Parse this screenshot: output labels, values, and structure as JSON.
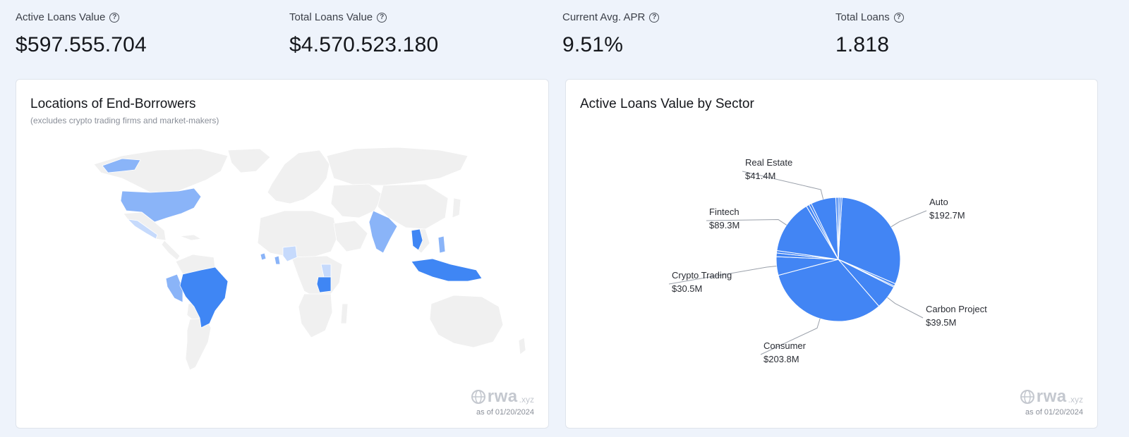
{
  "stats": [
    {
      "label": "Active Loans Value",
      "value": "$597.555.704"
    },
    {
      "label": "Total Loans Value",
      "value": "$4.570.523.180"
    },
    {
      "label": "Current Avg. APR",
      "value": "9.51%"
    },
    {
      "label": "Total Loans",
      "value": "1.818"
    }
  ],
  "help_icon_glyph": "?",
  "map_card": {
    "title": "Locations of End-Borrowers",
    "subtitle": "(excludes crypto trading firms and market-makers)",
    "watermark_brand": "rwa",
    "watermark_suffix": ".xyz",
    "as_of": "as of 01/20/2024"
  },
  "sector_card": {
    "title": "Active Loans Value by Sector",
    "watermark_brand": "rwa",
    "watermark_suffix": ".xyz",
    "as_of": "as of 01/20/2024"
  },
  "colors": {
    "dark_blue": "#3f86f4",
    "mid_blue": "#8ab4f8",
    "light_blue": "#c6dafc",
    "land": "#f0f0f0",
    "border": "#ffffff"
  },
  "map_highlights": [
    {
      "country": "Brazil",
      "shade": "dark"
    },
    {
      "country": "Tanzania",
      "shade": "dark"
    },
    {
      "country": "Thailand",
      "shade": "dark"
    },
    {
      "country": "Indonesia",
      "shade": "dark"
    },
    {
      "country": "Philippines",
      "shade": "mid"
    },
    {
      "country": "India",
      "shade": "mid"
    },
    {
      "country": "United States",
      "shade": "mid"
    },
    {
      "country": "Alaska",
      "shade": "mid"
    },
    {
      "country": "Mexico",
      "shade": "light"
    },
    {
      "country": "Peru",
      "shade": "mid"
    },
    {
      "country": "Nigeria",
      "shade": "light"
    },
    {
      "country": "Kenya",
      "shade": "light"
    },
    {
      "country": "Ghana",
      "shade": "mid"
    },
    {
      "country": "Sierra Leone",
      "shade": "mid"
    }
  ],
  "chart_data": {
    "type": "pie",
    "title": "Active Loans Value by Sector",
    "slices": [
      {
        "label": "Auto",
        "value": 192.7,
        "display": "$192.7M"
      },
      {
        "label": "",
        "value": 4.0,
        "display": ""
      },
      {
        "label": "",
        "value": 2.0,
        "display": ""
      },
      {
        "label": "Carbon Project",
        "value": 39.5,
        "display": "$39.5M"
      },
      {
        "label": "Consumer",
        "value": 203.8,
        "display": "$203.8M"
      },
      {
        "label": "Crypto Trading",
        "value": 30.5,
        "display": "$30.5M"
      },
      {
        "label": "",
        "value": 6.0,
        "display": ""
      },
      {
        "label": "",
        "value": 4.0,
        "display": ""
      },
      {
        "label": "Fintech",
        "value": 89.3,
        "display": "$89.3M"
      },
      {
        "label": "",
        "value": 5.0,
        "display": ""
      },
      {
        "label": "",
        "value": 4.0,
        "display": ""
      },
      {
        "label": "Real Estate",
        "value": 41.4,
        "display": "$41.4M"
      },
      {
        "label": "",
        "value": 4.0,
        "display": ""
      },
      {
        "label": "",
        "value": 3.0,
        "display": ""
      },
      {
        "label": "",
        "value": 3.0,
        "display": ""
      }
    ],
    "color": "#4285f4"
  }
}
